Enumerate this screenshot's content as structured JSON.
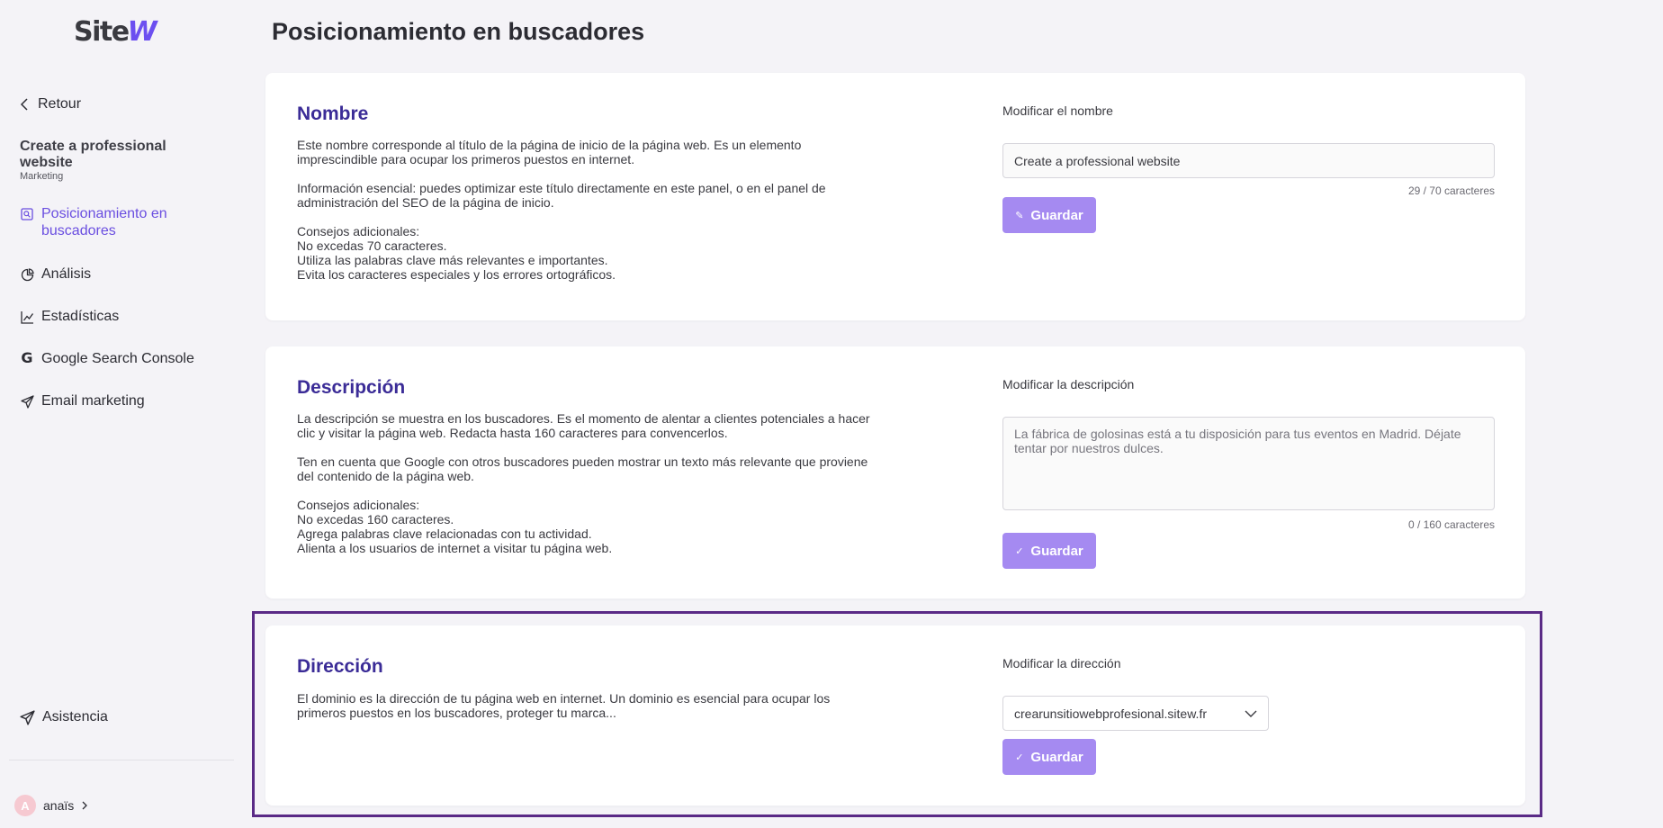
{
  "brand": {
    "logo_text_a": "Site",
    "logo_text_b": "W"
  },
  "sidebar": {
    "back_label": "Retour",
    "site_title": "Create a professional website",
    "site_category": "Marketing",
    "items": [
      {
        "label": "Posicionamiento en buscadores",
        "icon": "seo-search-icon",
        "active": true
      },
      {
        "label": "Análisis",
        "icon": "analysis-icon"
      },
      {
        "label": "Estadísticas",
        "icon": "chart-icon"
      },
      {
        "label": "Google Search Console",
        "icon": "google-icon"
      },
      {
        "label": "Email marketing",
        "icon": "send-icon"
      }
    ],
    "assistance_label": "Asistencia",
    "user_initial": "A",
    "user_name": "anaïs"
  },
  "page": {
    "title": "Posicionamiento en buscadores"
  },
  "name_section": {
    "heading": "Nombre",
    "paragraphs": [
      "Este nombre corresponde al título de la página de inicio de la página web. Es un elemento imprescindible para ocupar los primeros puestos en internet.",
      "Información esencial: puedes optimizar este título directamente en este panel, o en el panel de administración del SEO de la página de inicio.",
      "Consejos adicionales:",
      "No excedas 70 caracteres.",
      "Utiliza las palabras clave más relevantes e importantes.",
      "Evita los caracteres especiales y los errores ortográficos."
    ],
    "field_label": "Modificar el nombre",
    "value": "Create a professional website",
    "counter": "29 / 70 caracteres",
    "save_label": "Guardar"
  },
  "description_section": {
    "heading": "Descripción",
    "paragraphs": [
      "La descripción se muestra en los buscadores. Es el momento de alentar a clientes potenciales a hacer clic y visitar la página web. Redacta hasta 160 caracteres para convencerlos.",
      "Ten en cuenta que Google con otros buscadores pueden mostrar un texto más relevante que proviene del contenido de la página web.",
      "Consejos adicionales:",
      "No excedas 160 caracteres.",
      "Agrega palabras clave relacionadas con tu actividad.",
      "Alienta a los usuarios de internet a visitar tu página web."
    ],
    "field_label": "Modificar la descripción",
    "placeholder": "La fábrica de golosinas está a tu disposición para tus eventos en Madrid. Déjate tentar por nuestros dulces.",
    "counter": "0 / 160 caracteres",
    "save_label": "Guardar"
  },
  "address_section": {
    "heading": "Dirección",
    "paragraphs": [
      "El dominio es la dirección de tu página web en internet. Un dominio es esencial para ocupar los primeros puestos en los buscadores, proteger tu marca..."
    ],
    "field_label": "Modificar la dirección",
    "selected_domain": "crearunsitiowebprofesional.sitew.fr",
    "save_label": "Guardar"
  },
  "colors": {
    "accent": "#6a4ee0",
    "button": "#a58af1",
    "heading": "#3b2c97",
    "highlight": "#5a2a86"
  }
}
